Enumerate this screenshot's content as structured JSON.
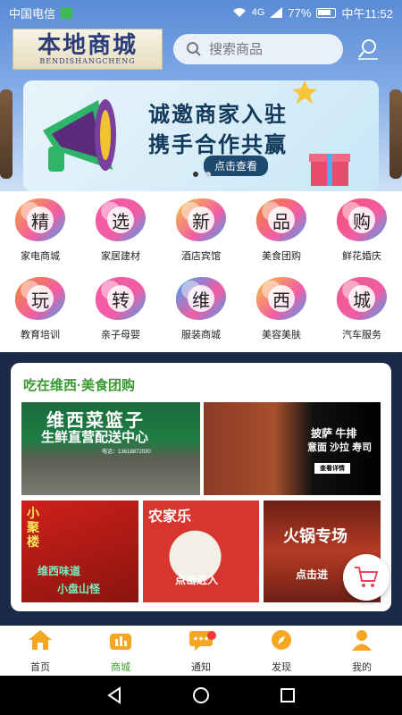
{
  "status_bar": {
    "carrier": "中国电信",
    "signal": "4G",
    "battery": "77%",
    "time": "中午11:52"
  },
  "header": {
    "logo_title": "本地商城",
    "logo_subtitle": "BENDISHANGCHENG",
    "search_placeholder": "搜索商品"
  },
  "banner": {
    "line1": "诚邀商家入驻",
    "line2": "携手合作共赢",
    "button": "点击查看",
    "slide_count": 2,
    "active_slide": 0
  },
  "categories": [
    {
      "char": "精",
      "label": "家电商城",
      "color": "#f7a63a"
    },
    {
      "char": "选",
      "label": "家居建材",
      "color": "#f25ca4"
    },
    {
      "char": "新",
      "label": "酒店宾馆",
      "color": "#f4c93a"
    },
    {
      "char": "品",
      "label": "美食团购",
      "color": "#f5852d"
    },
    {
      "char": "购",
      "label": "鲜花婚庆",
      "color": "#f44f6a"
    },
    {
      "char": "玩",
      "label": "教育培训",
      "color": "#f38a2f"
    },
    {
      "char": "转",
      "label": "亲子母婴",
      "color": "#f25ca4"
    },
    {
      "char": "维",
      "label": "服装商城",
      "color": "#3aa6f2"
    },
    {
      "char": "西",
      "label": "美容美肤",
      "color": "#f7c53a"
    },
    {
      "char": "城",
      "label": "汽车服务",
      "color": "#f05a8a"
    }
  ],
  "food_section": {
    "title": "吃在维西·美食团购",
    "tile_a_line1": "维西菜篮子",
    "tile_a_line2": "生鲜直营配送中心",
    "tile_a_phone": "电话：13618872030",
    "tile_b_line1": "披萨 牛排",
    "tile_b_line2": "意面 沙拉 寿司",
    "tile_b_button": "查看详情",
    "tile_c_title": "小聚楼",
    "tile_c_sub1": "维西味道",
    "tile_c_sub2": "小盘山怪",
    "tile_d_title": "农家乐",
    "tile_d_button": "点击进入",
    "tile_e_title": "火锅专场",
    "tile_e_button": "点击进"
  },
  "bottom_nav": [
    {
      "label": "首页",
      "icon": "home-icon",
      "active": false
    },
    {
      "label": "商城",
      "icon": "shop-icon",
      "active": true
    },
    {
      "label": "通知",
      "icon": "message-icon",
      "active": false,
      "badge": true
    },
    {
      "label": "发现",
      "icon": "compass-icon",
      "active": false
    },
    {
      "label": "我的",
      "icon": "user-icon",
      "active": false
    }
  ],
  "colors": {
    "accent_green": "#3a9a2f",
    "nav_icon_orange": "#f5a623",
    "badge_red": "#f23a3a"
  }
}
